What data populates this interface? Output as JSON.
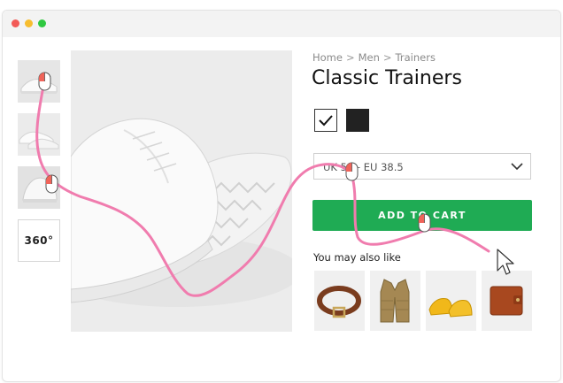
{
  "window": {
    "controls": [
      "close",
      "minimize",
      "maximize"
    ]
  },
  "gallery": {
    "thumbnails": [
      {
        "icon": "sneaker-side-view"
      },
      {
        "icon": "sneaker-pair-view"
      },
      {
        "icon": "sneaker-front-view"
      }
    ],
    "view360_label": "360°"
  },
  "breadcrumb": {
    "items": [
      "Home",
      "Men",
      "Trainers"
    ],
    "separator": ">"
  },
  "product": {
    "title": "Classic Trainers",
    "colors": [
      {
        "name": "white",
        "hex": "#ffffff",
        "selected": true
      },
      {
        "name": "black",
        "hex": "#222222",
        "selected": false
      }
    ],
    "size_value": "UK 5 — EU 38.5",
    "add_to_cart_label": "ADD TO CART",
    "accent_color": "#1fab54"
  },
  "recommendations": {
    "heading": "You may also like",
    "items": [
      {
        "icon": "belt-icon"
      },
      {
        "icon": "vest-icon"
      },
      {
        "icon": "yellow-shoes-icon"
      },
      {
        "icon": "wallet-icon"
      }
    ]
  },
  "mouse_trail": {
    "color": "#f07cae"
  }
}
